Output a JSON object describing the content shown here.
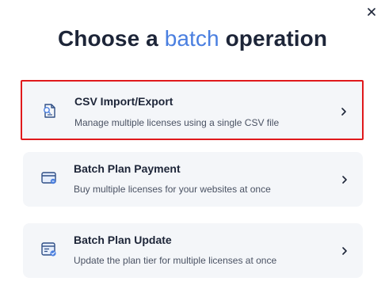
{
  "dialog": {
    "title_part1": "Choose a ",
    "title_accent": "batch",
    "title_part2": " operation",
    "close_icon": "close-icon",
    "accent_color": "#4a7fe0",
    "highlight_color": "#e0191c"
  },
  "options": [
    {
      "icon": "csv-file-icon",
      "title": "CSV Import/Export",
      "description": "Manage multiple licenses using a single CSV file",
      "selected": true
    },
    {
      "icon": "card-payment-icon",
      "title": "Batch Plan Payment",
      "description": "Buy multiple licenses for your websites at once",
      "selected": false
    },
    {
      "icon": "plan-update-icon",
      "title": "Batch Plan Update",
      "description": "Update the plan tier for multiple licenses at once",
      "selected": false
    }
  ]
}
